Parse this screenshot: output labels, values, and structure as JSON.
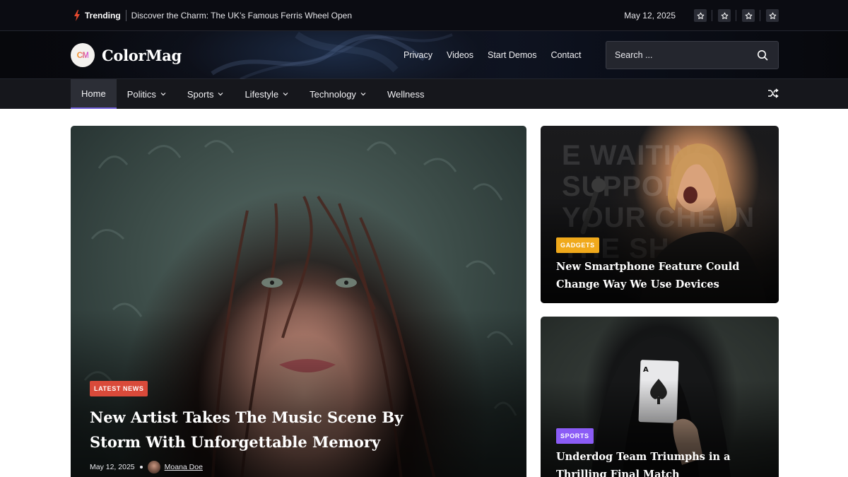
{
  "topbar": {
    "trending_label": "Trending",
    "trending_text": "Discover the Charm: The UK’s Famous Ferris Wheel Open",
    "date": "May 12, 2025",
    "social_icons": [
      "star-icon",
      "star-icon",
      "star-icon",
      "star-icon"
    ]
  },
  "header": {
    "logo_initials": "CM",
    "site_name": "ColorMag",
    "nav": [
      "Privacy",
      "Videos",
      "Start Demos",
      "Contact"
    ],
    "search_placeholder": "Search ..."
  },
  "mainnav": {
    "items": [
      {
        "label": "Home",
        "active": true,
        "dropdown": false
      },
      {
        "label": "Politics",
        "active": false,
        "dropdown": true
      },
      {
        "label": "Sports",
        "active": false,
        "dropdown": true
      },
      {
        "label": "Lifestyle",
        "active": false,
        "dropdown": true
      },
      {
        "label": "Technology",
        "active": false,
        "dropdown": true
      },
      {
        "label": "Wellness",
        "active": false,
        "dropdown": false
      }
    ],
    "accent_color": "#6d5bd6"
  },
  "featured": {
    "category": "LATEST NEWS",
    "category_color": "#d94a3a",
    "title": "New Artist Takes The Music Scene By Storm With Unforgettable Memory",
    "date": "May 12, 2025",
    "author": "Moana Doe"
  },
  "side_posts": [
    {
      "category": "GADGETS",
      "category_color": "#f0a91b",
      "title": "New Smartphone Feature Could Change Way We Use Devices",
      "background_text": "E WAITING SUPPORT YOUR CHE IN THE SH"
    },
    {
      "category": "SPORTS",
      "category_color": "#8b5cf6",
      "title": "Underdog Team Triumphs in a Thrilling Final Match"
    }
  ]
}
